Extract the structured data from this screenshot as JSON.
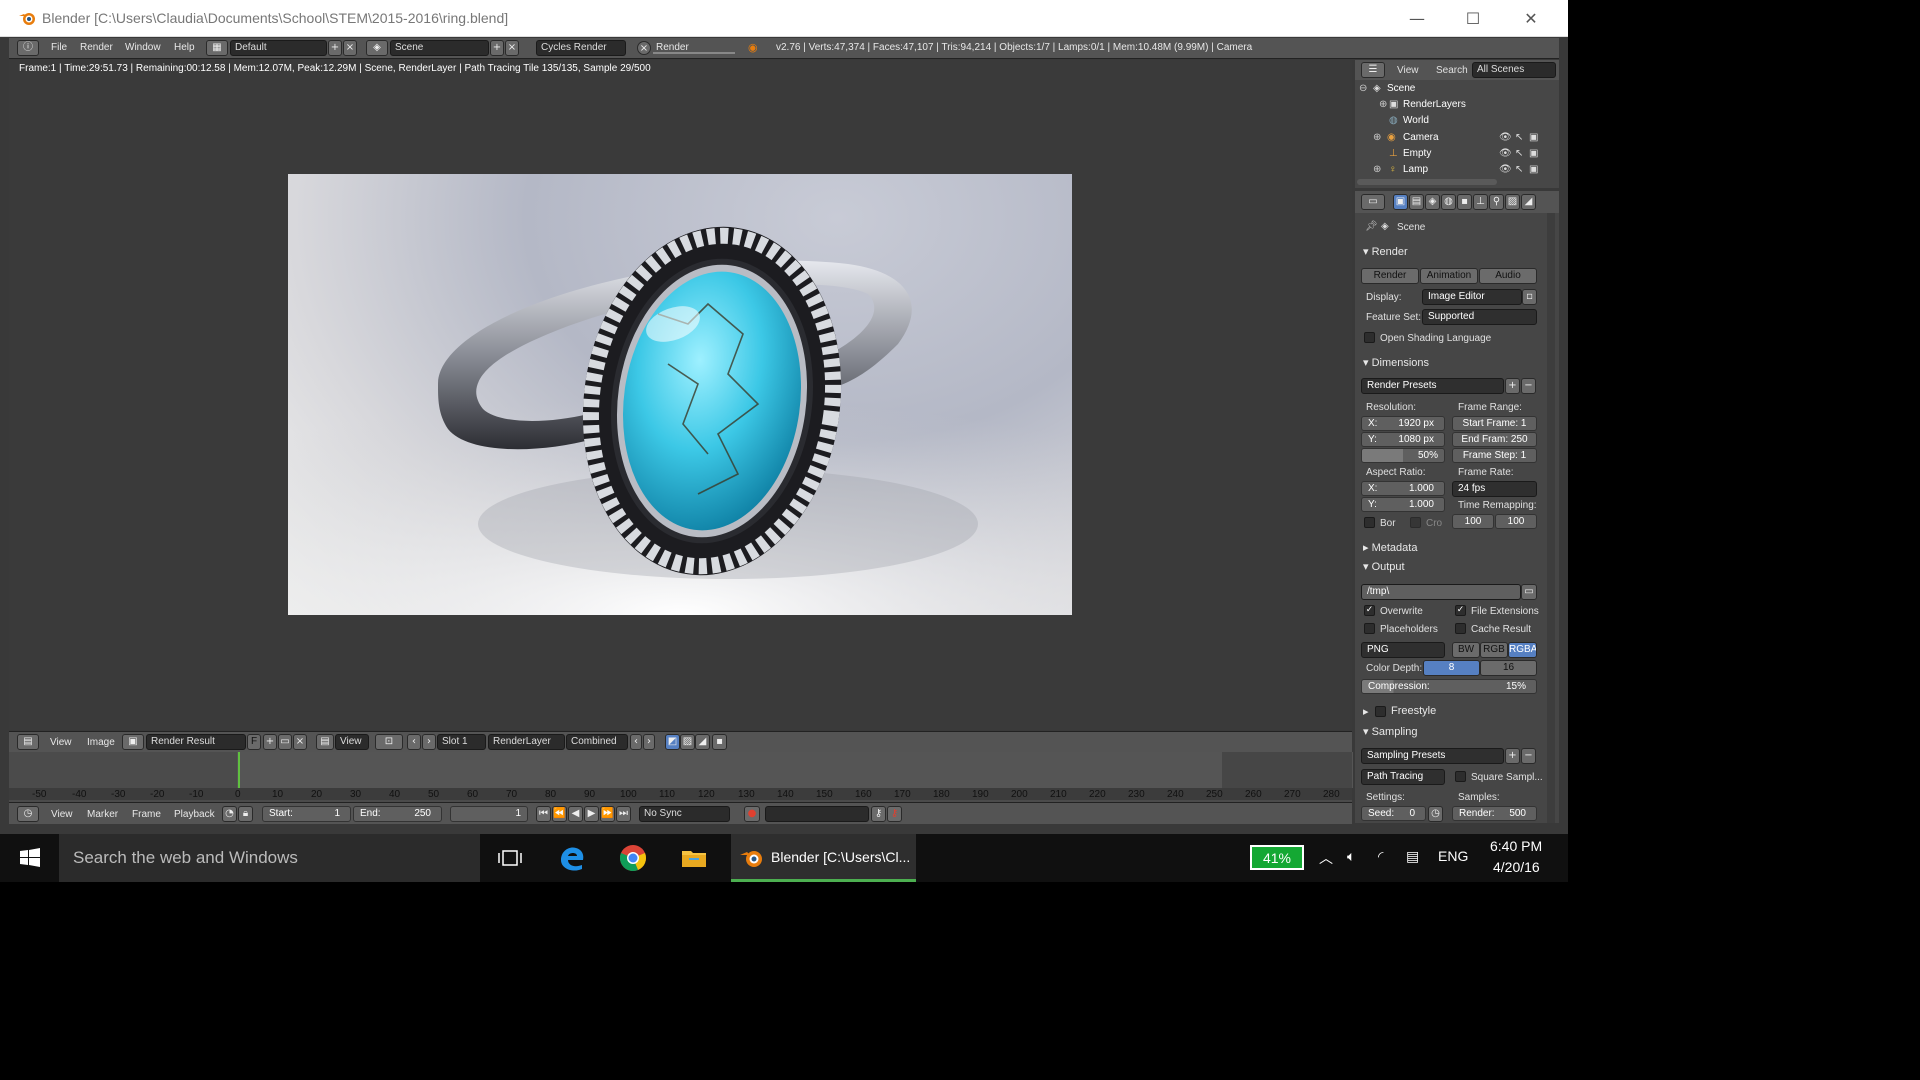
{
  "window": {
    "title": "Blender [C:\\Users\\Claudia\\Documents\\School\\STEM\\2015-2016\\ring.blend]",
    "minimize_glyph": "—",
    "maximize_glyph": "☐",
    "close_glyph": "✕"
  },
  "header": {
    "menus": [
      "File",
      "Render",
      "Window",
      "Help"
    ],
    "layout": "Default",
    "scene": "Scene",
    "engine": "Cycles Render",
    "render_label": "Render",
    "stats": "v2.76 | Verts:47,374 | Faces:47,107 | Tris:94,214 | Objects:1/7 | Lamps:0/1 | Mem:10.48M (9.99M) | Camera"
  },
  "viewport": {
    "info": "Frame:1 | Time:29:51.73 | Remaining:00:12.58 | Mem:12.07M, Peak:12.29M | Scene, RenderLayer | Path Tracing Tile 135/135, Sample 29/500"
  },
  "image_editor": {
    "menus": [
      "View",
      "Image"
    ],
    "image_name": "Render Result",
    "f_label": "F",
    "view": "View",
    "slot": "Slot 1",
    "layer": "RenderLayer",
    "pass": "Combined"
  },
  "timeline": {
    "ticks": [
      "-50",
      "-40",
      "-30",
      "-20",
      "-10",
      "0",
      "10",
      "20",
      "30",
      "40",
      "50",
      "60",
      "70",
      "80",
      "90",
      "100",
      "110",
      "120",
      "130",
      "140",
      "150",
      "160",
      "170",
      "180",
      "190",
      "200",
      "210",
      "220",
      "230",
      "240",
      "250",
      "260",
      "270",
      "280"
    ],
    "menus": [
      "View",
      "Marker",
      "Frame",
      "Playback"
    ],
    "start_label": "Start:",
    "start": "1",
    "end_label": "End:",
    "end": "250",
    "current": "1",
    "sync": "No Sync"
  },
  "outliner": {
    "menus": [
      "View",
      "Search"
    ],
    "filter": "All Scenes",
    "items": [
      "Scene",
      "RenderLayers",
      "World",
      "Camera",
      "Empty",
      "Lamp"
    ]
  },
  "properties": {
    "context": "Scene",
    "render": {
      "title": "Render",
      "buttons": [
        "Render",
        "Animation",
        "Audio"
      ],
      "display_label": "Display:",
      "display": "Image Editor",
      "feature_label": "Feature Set:",
      "feature": "Supported",
      "osl": "Open Shading Language"
    },
    "dimensions": {
      "title": "Dimensions",
      "presets": "Render Presets",
      "resolution_label": "Resolution:",
      "res_x": "X:",
      "res_x_val": "1920 px",
      "res_y": "Y:",
      "res_y_val": "1080 px",
      "res_pct": "50%",
      "frame_range_label": "Frame Range:",
      "start_frame": "Start Frame: 1",
      "end_frame": "End Fram: 250",
      "frame_step": "Frame Step: 1",
      "aspect_label": "Aspect Ratio:",
      "asp_x": "X:",
      "asp_x_val": "1.000",
      "asp_y": "Y:",
      "asp_y_val": "1.000",
      "frame_rate_label": "Frame Rate:",
      "fps": "24 fps",
      "time_remap_label": "Time Remapping:",
      "remap_old": "100",
      "remap_new": "100",
      "bor": "Bor",
      "cro": "Cro"
    },
    "metadata": "Metadata",
    "output": {
      "title": "Output",
      "path": "/tmp\\",
      "overwrite": "Overwrite",
      "file_ext": "File Extensions",
      "placeholders": "Placeholders",
      "cache": "Cache Result",
      "format": "PNG",
      "bw": "BW",
      "rgb": "RGB",
      "rgba": "RGBA",
      "depth_label": "Color Depth:",
      "depth_8": "8",
      "depth_16": "16",
      "compression": "Compression:",
      "compression_val": "15%"
    },
    "freestyle": "Freestyle",
    "sampling": {
      "title": "Sampling",
      "presets": "Sampling Presets",
      "method": "Path Tracing",
      "square": "Square Sampl...",
      "settings_label": "Settings:",
      "samples_label": "Samples:",
      "seed": "Seed:",
      "seed_val": "0",
      "render": "Render:",
      "render_val": "500"
    }
  },
  "taskbar": {
    "search_placeholder": "Search the web and Windows",
    "active_app": "Blender [C:\\Users\\Cl...",
    "battery": "41%",
    "lang": "ENG",
    "time": "6:40 PM",
    "date": "4/20/16"
  }
}
